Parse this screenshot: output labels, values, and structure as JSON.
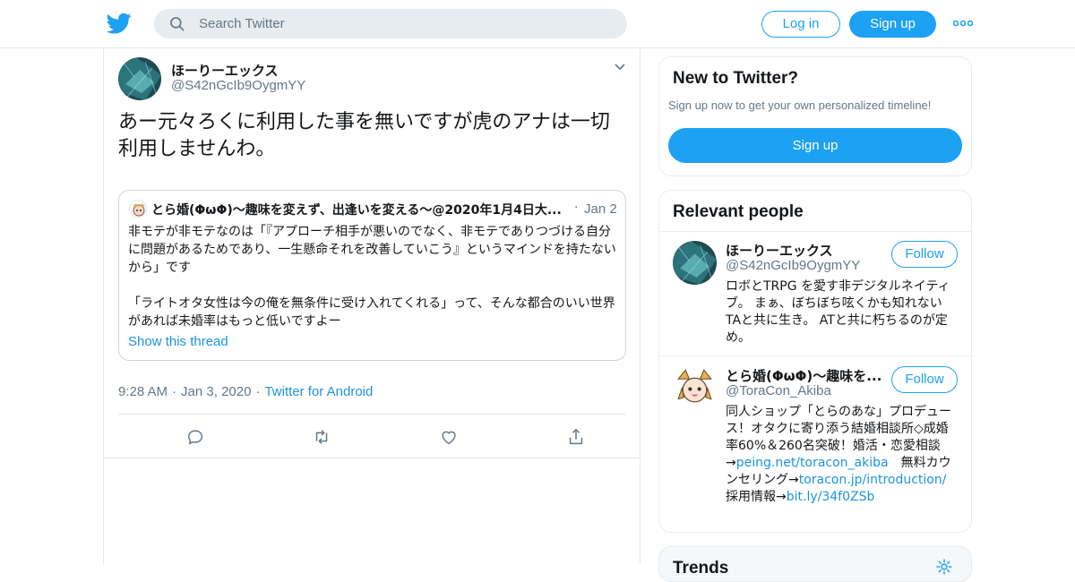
{
  "topbar": {
    "search_placeholder": "Search Twitter",
    "login_label": "Log in",
    "signup_label": "Sign up"
  },
  "tweet": {
    "author_name": "ほーりーエックス",
    "author_handle": "@S42nGcIb9OygmYY",
    "text": "あー元々ろくに利用した事を無いですが虎のアナは一切利用しませんわ。",
    "quoted": {
      "author_name": "とら婚(ΦωΦ)～趣味を変えず、出逢いを変える～@2020年1月4日大...",
      "dot": "·",
      "date": "Jan 2",
      "body": "非モテが非モテなのは「『アプローチ相手が悪いのでなく、非モテでありつづける自分に問題があるためであり、一生懸命それを改善していこう』というマインドを持たないから」です\n\n「ライトオタ女性は今の俺を無条件に受け入れてくれる」って、そんな都合のいい世界があれば未婚率はもっと低いですよー",
      "show_thread": "Show this thread"
    },
    "time": "9:28 AM",
    "date": "Jan 3, 2020",
    "sep": "·",
    "source": "Twitter for Android"
  },
  "sidebar": {
    "new_to_twitter": {
      "title": "New to Twitter?",
      "subtitle": "Sign up now to get your own personalized timeline!",
      "signup_label": "Sign up"
    },
    "relevant": {
      "title": "Relevant people",
      "people": [
        {
          "name": "ほーりーエックス",
          "handle": "@S42nGcIb9OygmYY",
          "follow_label": "Follow",
          "bio": "ロボとTRPG を愛す非デジタルネイティブ。 まぁ、ぼちぼち呟くかも知れない TAと共に生き。 ATと共に朽ちるのが定め。"
        },
        {
          "name": "とら婚(ΦωΦ)～趣味を...",
          "handle": "@ToraCon_Akiba",
          "follow_label": "Follow",
          "bio_prefix": "同人ショップ「とらのあな」プロデュース！オタクに寄り添う結婚相談所◇成婚率60%＆260名突破！婚活・恋愛相談→",
          "link1": "peing.net/toracon_akiba",
          "bio_mid": "　無料カウンセリング→",
          "link2": "toracon.jp/introduction/",
          "bio_mid2": " 採用情報→",
          "link3": "bit.ly/34f0ZSb"
        }
      ]
    },
    "trends": {
      "title": "Trends"
    }
  },
  "colors": {
    "accent": "#1da1f2",
    "link": "#1b95e0",
    "muted": "#657786",
    "border": "#e1e8ed"
  },
  "icons": [
    "twitter-bird-icon",
    "search-icon",
    "more-icon",
    "chevron-down-icon",
    "reply-icon",
    "retweet-icon",
    "like-icon",
    "share-icon",
    "gear-icon"
  ]
}
